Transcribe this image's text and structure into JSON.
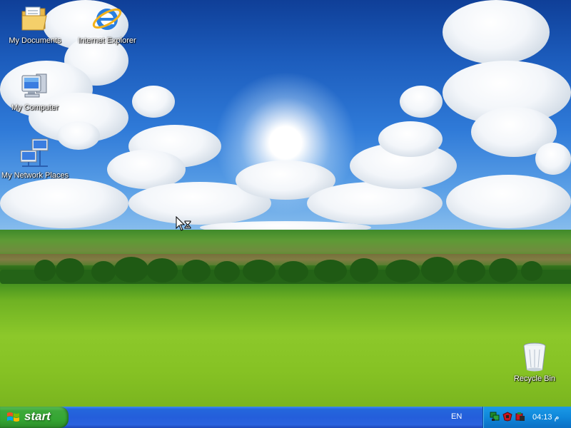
{
  "desktop": {
    "icons": [
      {
        "label": "My Documents",
        "icon": "my-documents-folder-icon"
      },
      {
        "label": "Internet Explorer",
        "icon": "internet-explorer-icon"
      },
      {
        "label": "My Computer",
        "icon": "my-computer-icon"
      },
      {
        "label": "My Network Places",
        "icon": "my-network-places-icon"
      },
      {
        "label": "Recycle Bin",
        "icon": "recycle-bin-icon"
      }
    ]
  },
  "taskbar": {
    "start_label": "start",
    "language": "EN",
    "clock": "04:13 م",
    "tray_icons": [
      "network-icon",
      "security-icon",
      "volume-icon"
    ]
  },
  "colors": {
    "taskbar": "#245edb",
    "start_button": "#3da83a",
    "tray": "#0f87da"
  }
}
